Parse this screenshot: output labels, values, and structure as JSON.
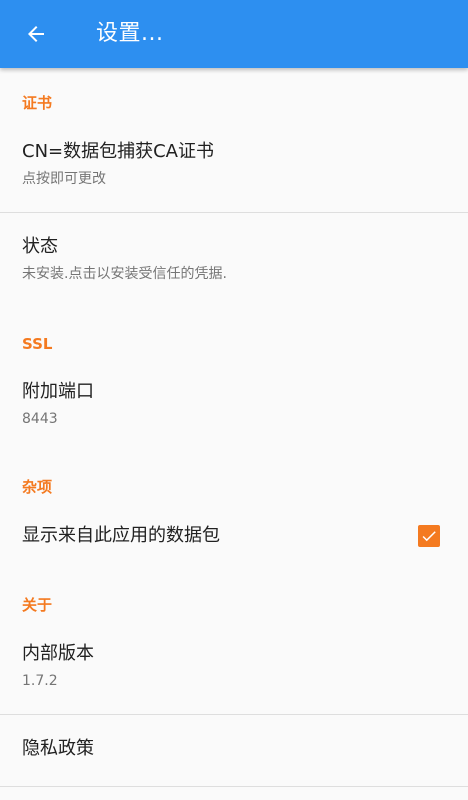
{
  "app_bar": {
    "title": "设置...",
    "back_icon": "arrow-left-icon"
  },
  "colors": {
    "primary": "#2d8ff0",
    "accent": "#f47a20"
  },
  "sections": {
    "certificate": {
      "header": "证书",
      "ca_cert": {
        "title": "CN=数据包捕获CA证书",
        "summary": "点按即可更改"
      },
      "status": {
        "title": "状态",
        "summary": "未安装.点击以安装受信任的凭据."
      }
    },
    "ssl": {
      "header": "SSL",
      "extra_port": {
        "title": "附加端口",
        "summary": "8443"
      }
    },
    "misc": {
      "header": "杂项",
      "show_own_packets": {
        "title": "显示来自此应用的数据包",
        "checked": true
      }
    },
    "about": {
      "header": "关于",
      "build_version": {
        "title": "内部版本",
        "summary": "1.7.2"
      },
      "privacy": {
        "title": "隐私政策"
      }
    }
  }
}
